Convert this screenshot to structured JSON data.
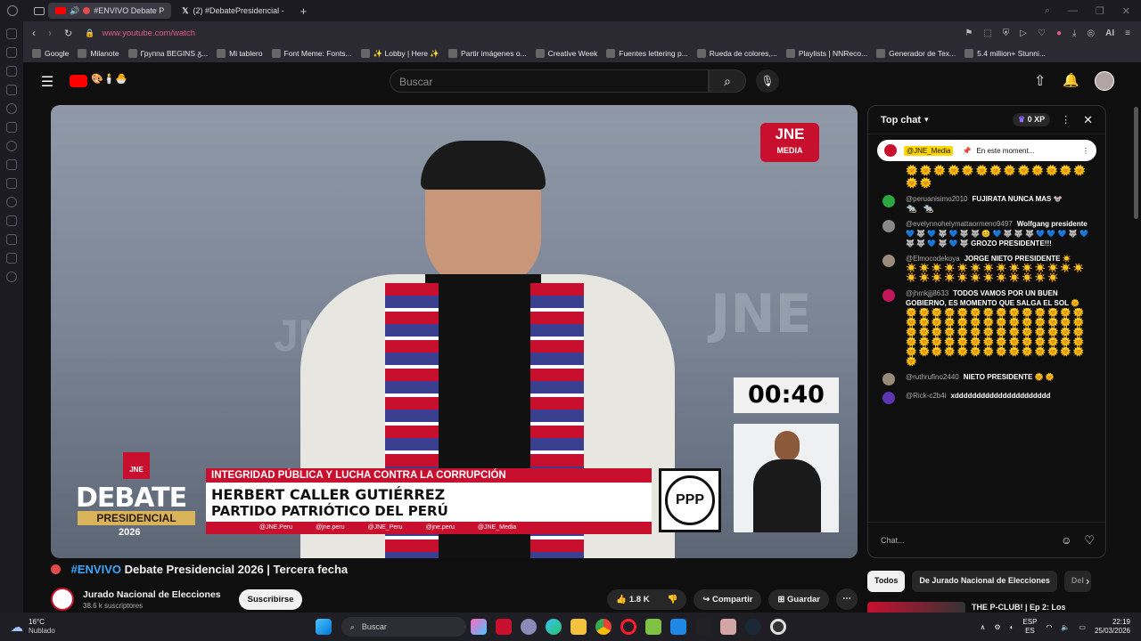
{
  "browser": {
    "tabs": [
      {
        "label": "#ENVIVO Debate P"
      },
      {
        "label": "(2) #DebatePresidencial -"
      }
    ],
    "url": "www.youtube.com/watch",
    "bookmarks": [
      "Google",
      "Milanote",
      "Группа BEGINS ᵹ...",
      "Mi tablero",
      "Font Meme: Fonts...",
      "✨ Lobby | Here ✨",
      "Partir imágenes o...",
      "Creative Week",
      "Fuentes lettering p...",
      "Rueda de colores,...",
      "Playlists | NNReco...",
      "Generador de Tex...",
      "5.4 million+ Stunni..."
    ],
    "ai_label": "AI"
  },
  "youtube": {
    "search_placeholder": "Buscar"
  },
  "video": {
    "brand": "JNE",
    "brand_sub": "MEDIA",
    "timer": "00:40",
    "lower_third_topic": "INTEGRIDAD PÚBLICA Y LUCHA CONTRA LA CORRUPCIÓN",
    "candidate_name": "HERBERT CALLER GUTIÉRREZ",
    "party": "PARTIDO PATRIÓTICO DEL PERÚ",
    "party_logo": "PPP",
    "debate_title_1": "DEBATE",
    "debate_title_2": "PRESIDENCIAL",
    "debate_year": "2026",
    "jne_badge": "JNE",
    "socials": [
      "@JNE.Peru",
      "@jne.peru",
      "@JNE_Peru",
      "@jne.peru",
      "@JNE_Media"
    ]
  },
  "meta": {
    "live_tag": "#ENVIVO",
    "title_rest": " Debate Presidencial 2026 | Tercera fecha",
    "channel": "Jurado Nacional de Elecciones",
    "subs": "38.6 k suscriptores",
    "subscribe": "Suscribirse",
    "likes": "1.8 K",
    "share": "Compartir",
    "save": "Guardar"
  },
  "chat": {
    "header": "Top chat",
    "xp": "0 XP",
    "pinned_author": "@JNE_Media",
    "pinned_text": "En este moment...",
    "input_placeholder": "Chat...",
    "messages": [
      {
        "author": "@peruanisimo2010",
        "text": "FUJIRATA NUNCA MAS 🐭",
        "emojis": "🐀 🐀",
        "color": "#2ba640"
      },
      {
        "author": "@evelynnohelymattaormeno9497",
        "text": "Wolfgang presidente 💙 🐺 💙 🐺 💙 🐺 🐺 😊 💙 🐺 🐺 🐺 💙 💙 💙 🐺 💙 🐺 🐺 💙 🐺 💙 🐺 GROZO PRESIDENTE!!!",
        "emojis": "",
        "color": "#888888"
      },
      {
        "author": "@Elmocodekoya",
        "text": "JORGE NIETO PRESIDENTE ☀️",
        "emojis": "☀️☀️☀️☀️☀️☀️☀️☀️☀️☀️☀️☀️☀️☀️☀️☀️☀️☀️☀️☀️☀️☀️☀️☀️☀️☀️",
        "color": "#9a8a7a"
      },
      {
        "author": "@jhmkjjj8633",
        "text": "TODOS VAMOS POR UN BUEN GOBIERNO, ES MOMENTO QUE SALGA EL SOL 🌞",
        "emojis": "🌞🌞🌞🌞🌞🌞🌞🌞🌞🌞🌞🌞🌞🌞🌞🌞🌞🌞🌞🌞🌞🌞🌞🌞🌞🌞🌞🌞🌞🌞🌞🌞🌞🌞🌞🌞🌞🌞🌞🌞🌞🌞🌞🌞🌞🌞🌞🌞🌞🌞🌞🌞🌞🌞🌞🌞🌞🌞🌞🌞🌞🌞🌞🌞🌞🌞🌞🌞🌞🌞🌞",
        "color": "#c2185b"
      },
      {
        "author": "@ruthrufino2440",
        "text": "NIETO PRESIDENTE 🌞 🌞",
        "emojis": "",
        "color": "#9a8a7a"
      },
      {
        "author": "@Rick-c2b4i",
        "text": "xdddddddddddddddddddddd",
        "emojis": "",
        "color": "#5e35b1"
      }
    ],
    "top_emojis": "🌞🌞🌞🌞🌞🌞🌞🌞🌞🌞🌞🌞🌞🌞🌞"
  },
  "chips": [
    "Todos",
    "De Jurado Nacional de Elecciones",
    "Del"
  ],
  "next_video": "THE P-CLUB! | Ep 2: Los",
  "taskbar": {
    "weather_temp": "16°C",
    "weather_text": "Nublado",
    "search": "Buscar",
    "lang1": "ESP",
    "lang2": "ES",
    "time": "22:19",
    "date": "25/03/2026"
  },
  "colors": {
    "youtube_red": "#ff0000",
    "jne_red": "#c8102e",
    "link_blue": "#3ea6ff"
  }
}
